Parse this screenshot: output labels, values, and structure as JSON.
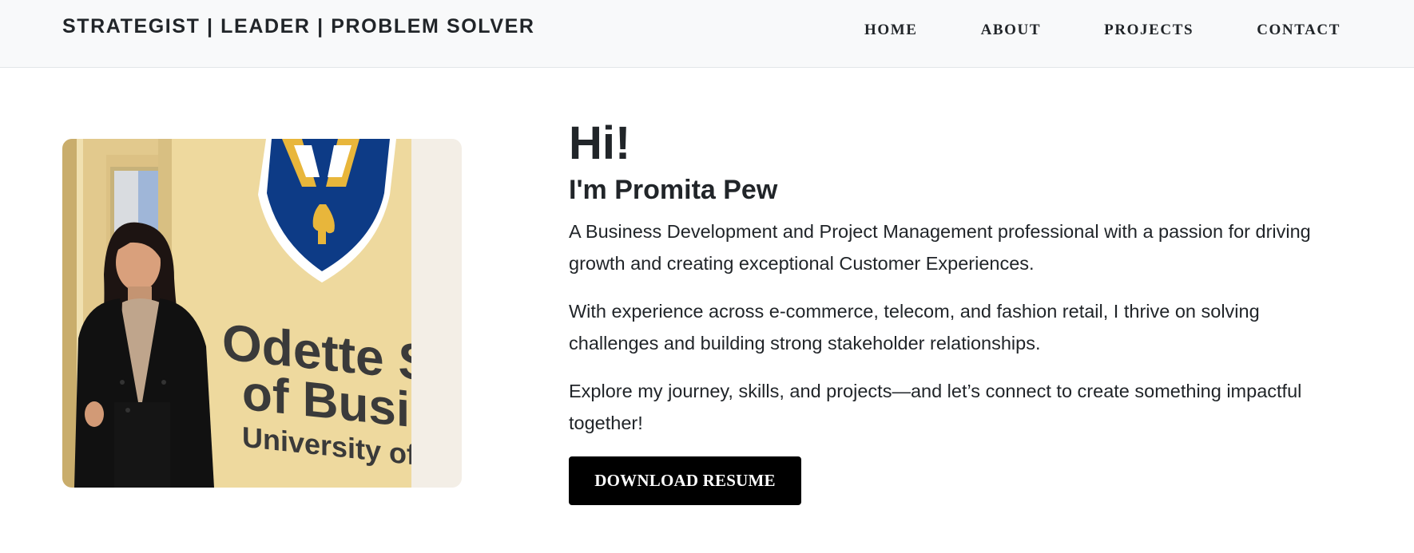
{
  "nav": {
    "brand": "STRATEGIST | LEADER | PROBLEM SOLVER",
    "links": [
      "HOME",
      "ABOUT",
      "PROJECTS",
      "CONTACT"
    ]
  },
  "hero": {
    "greeting": "Hi!",
    "name": "I'm Promita Pew",
    "paragraphs": [
      "A Business Development and Project Management professional with a passion for driving growth and creating exceptional Customer Experiences.",
      "With experience across e-commerce, telecom, and fashion retail, I thrive on solving challenges and building strong stakeholder relationships.",
      "Explore my journey, skills, and projects—and let’s connect to create something impactful together!"
    ],
    "button": "DOWNLOAD RESUME",
    "photo": {
      "sign_text": [
        "Odette Scho",
        "of Business",
        "University of Winds"
      ]
    }
  },
  "colors": {
    "navbar_bg": "#f8f9fa",
    "text": "#212529",
    "button_bg": "#000000",
    "button_text": "#ffffff",
    "wall": "#e9d49a",
    "shield_blue": "#0d3b86",
    "shield_gold": "#e8b63b"
  }
}
